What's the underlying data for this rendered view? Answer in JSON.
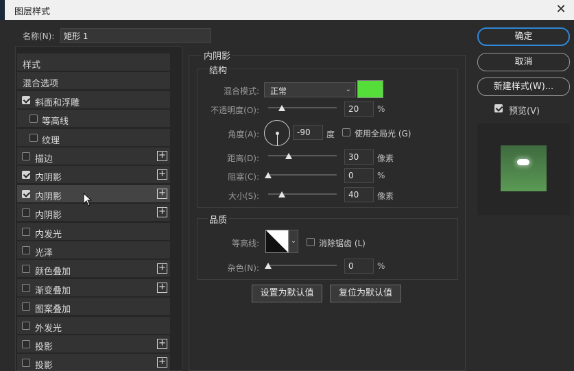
{
  "window": {
    "title": "图层样式",
    "close_symbol": "✕"
  },
  "name_row": {
    "label": "名称(N):",
    "value": "矩形 1"
  },
  "styles_list": {
    "items": [
      {
        "label": "样式",
        "checkbox": null,
        "plus": false,
        "indent": false,
        "selected": false
      },
      {
        "label": "混合选项",
        "checkbox": null,
        "plus": false,
        "indent": false,
        "selected": false
      },
      {
        "label": "斜面和浮雕",
        "checkbox": true,
        "plus": false,
        "indent": false,
        "selected": false
      },
      {
        "label": "等高线",
        "checkbox": false,
        "plus": false,
        "indent": true,
        "selected": false
      },
      {
        "label": "纹理",
        "checkbox": false,
        "plus": false,
        "indent": true,
        "selected": false
      },
      {
        "label": "描边",
        "checkbox": false,
        "plus": true,
        "indent": false,
        "selected": false
      },
      {
        "label": "内阴影",
        "checkbox": true,
        "plus": true,
        "indent": false,
        "selected": false
      },
      {
        "label": "内阴影",
        "checkbox": true,
        "plus": true,
        "indent": false,
        "selected": true
      },
      {
        "label": "内阴影",
        "checkbox": false,
        "plus": true,
        "indent": false,
        "selected": false
      },
      {
        "label": "内发光",
        "checkbox": false,
        "plus": false,
        "indent": false,
        "selected": false
      },
      {
        "label": "光泽",
        "checkbox": false,
        "plus": false,
        "indent": false,
        "selected": false
      },
      {
        "label": "颜色叠加",
        "checkbox": false,
        "plus": true,
        "indent": false,
        "selected": false
      },
      {
        "label": "渐变叠加",
        "checkbox": false,
        "plus": true,
        "indent": false,
        "selected": false
      },
      {
        "label": "图案叠加",
        "checkbox": false,
        "plus": false,
        "indent": false,
        "selected": false
      },
      {
        "label": "外发光",
        "checkbox": false,
        "plus": false,
        "indent": false,
        "selected": false
      },
      {
        "label": "投影",
        "checkbox": false,
        "plus": true,
        "indent": false,
        "selected": false
      },
      {
        "label": "投影",
        "checkbox": false,
        "plus": true,
        "indent": false,
        "selected": false
      }
    ],
    "plus_symbol": "+"
  },
  "inner_shadow": {
    "section_title": "内阴影",
    "structure": {
      "title": "结构",
      "blend_mode_label": "混合模式:",
      "blend_mode_value": "正常",
      "blend_color": "#55dd3a",
      "opacity_label": "不透明度(O):",
      "opacity_value": "20",
      "opacity_level": 0.2,
      "percent_unit": "%",
      "angle_label": "角度(A):",
      "angle_value": "-90",
      "angle_unit": "度",
      "global_light_label": "使用全局光 (G)",
      "global_light_checked": false,
      "distance_label": "距离(D):",
      "distance_value": "30",
      "distance_level": 0.3,
      "pixel_unit": "像素",
      "choke_label": "阻塞(C):",
      "choke_value": "0",
      "choke_level": 0,
      "size_label": "大小(S):",
      "size_value": "40",
      "size_level": 0.2
    },
    "quality": {
      "title": "品质",
      "contour_label": "等高线:",
      "anti_alias_label": "消除锯齿 (L)",
      "anti_alias_checked": false,
      "noise_label": "杂色(N):",
      "noise_value": "0",
      "noise_level": 0
    },
    "buttons": {
      "set_default": "设置为默认值",
      "reset_default": "复位为默认值"
    }
  },
  "right_panel": {
    "ok": "确定",
    "cancel": "取消",
    "new_style": "新建样式(W)...",
    "preview_label": "预览(V)",
    "preview_checked": true
  },
  "colors": {
    "accent": "#2f86d6",
    "panel_bg": "#2b2b2b",
    "preview_green": "#5b9a55"
  }
}
